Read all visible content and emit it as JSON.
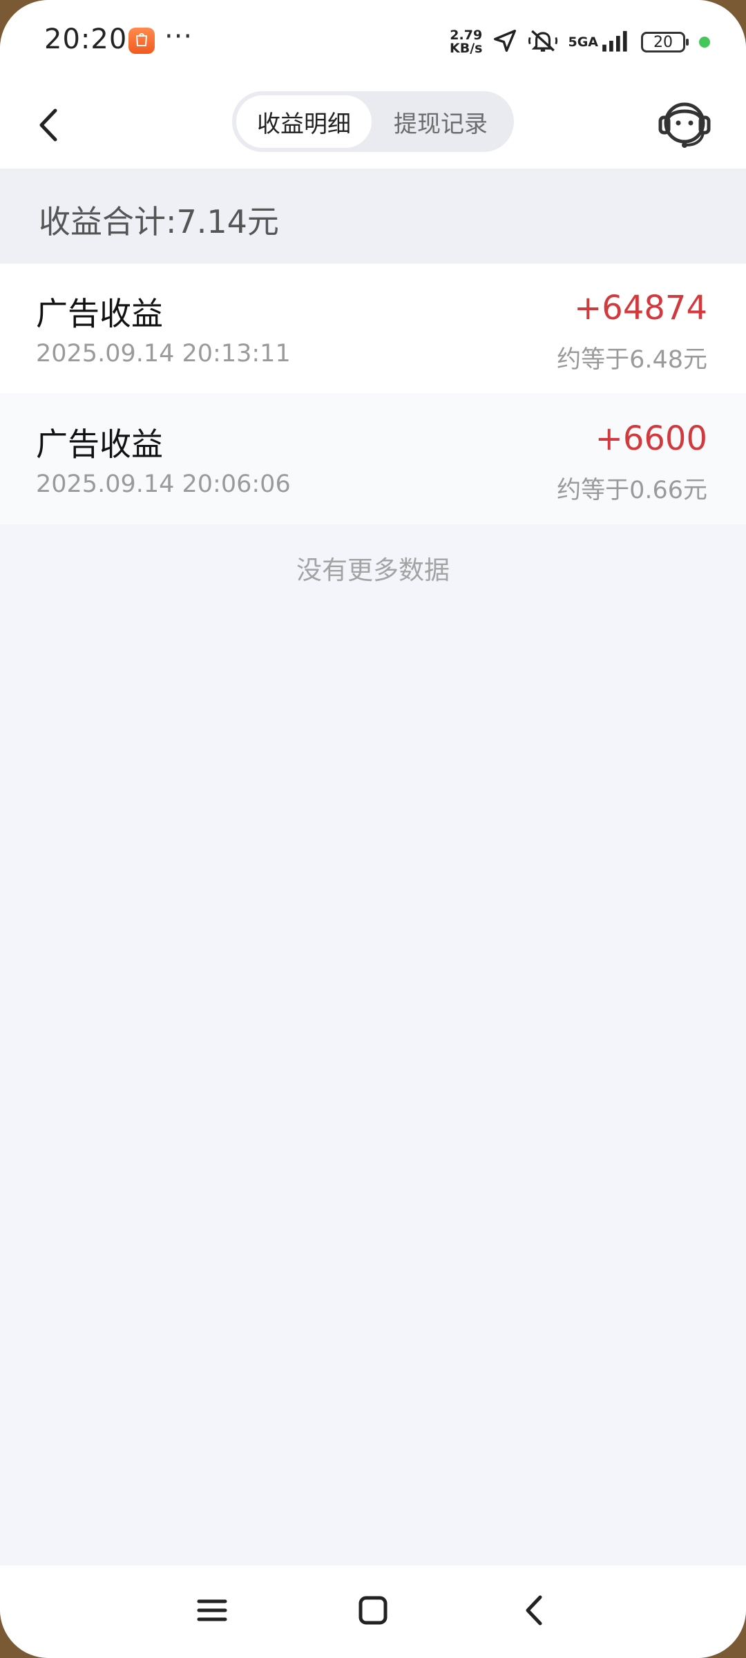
{
  "status_bar": {
    "time": "20:20",
    "more_dots": "···",
    "net_speed_value": "2.79",
    "net_speed_unit": "KB/s",
    "network_type": "5GA",
    "battery_level": "20",
    "icons": [
      "app-notification-icon",
      "location-arrow-icon",
      "mute-bell-icon",
      "signal-bars-icon",
      "battery-icon",
      "charging-dot-icon"
    ]
  },
  "header": {
    "tabs": [
      {
        "label": "收益明细",
        "active": true
      },
      {
        "label": "提现记录",
        "active": false
      }
    ],
    "icons": [
      "back-chevron-icon",
      "customer-service-icon"
    ]
  },
  "summary": {
    "text": "收益合计:7.14元"
  },
  "records": [
    {
      "title": "广告收益",
      "time": "2025.09.14 20:13:11",
      "amount": "+64874",
      "equivalent": "约等于6.48元"
    },
    {
      "title": "广告收益",
      "time": "2025.09.14 20:06:06",
      "amount": "+6600",
      "equivalent": "约等于0.66元"
    }
  ],
  "list_footer": "没有更多数据",
  "colors": {
    "amount": "#d2393d",
    "page_background": "#f3f5fa",
    "tab_track": "#e9ebf0"
  },
  "nav_bar": {
    "icons": [
      "menu-icon",
      "home-square-icon",
      "back-icon"
    ]
  }
}
